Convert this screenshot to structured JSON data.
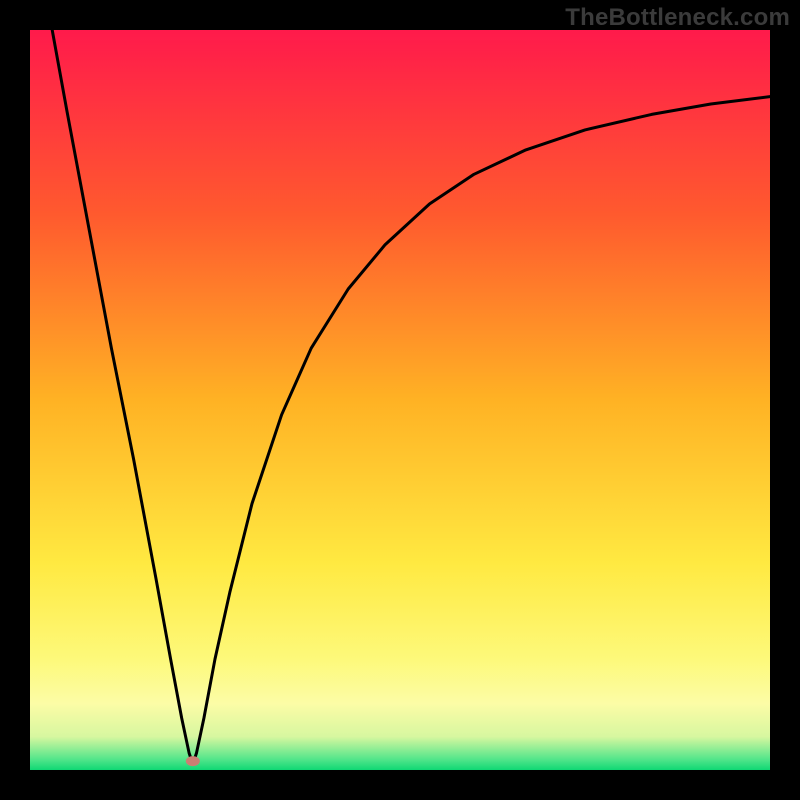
{
  "watermark": "TheBottleneck.com",
  "chart_data": {
    "type": "line",
    "title": "",
    "xlabel": "",
    "ylabel": "",
    "xlim": [
      0,
      100
    ],
    "ylim": [
      0,
      100
    ],
    "grid": false,
    "legend": false,
    "background_gradient": {
      "stops": [
        {
          "offset": 0.0,
          "color": "#ff1a4b"
        },
        {
          "offset": 0.25,
          "color": "#ff5a2e"
        },
        {
          "offset": 0.5,
          "color": "#ffb224"
        },
        {
          "offset": 0.72,
          "color": "#ffe941"
        },
        {
          "offset": 0.85,
          "color": "#fdf97a"
        },
        {
          "offset": 0.91,
          "color": "#fcfca6"
        },
        {
          "offset": 0.955,
          "color": "#d7f7a0"
        },
        {
          "offset": 0.985,
          "color": "#55e68b"
        },
        {
          "offset": 1.0,
          "color": "#0fd874"
        }
      ]
    },
    "marker": {
      "x": 22,
      "y": 1.2,
      "color": "#cc7f73"
    },
    "series": [
      {
        "name": "curve",
        "color": "#000000",
        "x": [
          3,
          5,
          8,
          11,
          14,
          17,
          19,
          20.5,
          21.5,
          22,
          22.5,
          23.5,
          25,
          27,
          30,
          34,
          38,
          43,
          48,
          54,
          60,
          67,
          75,
          84,
          92,
          100
        ],
        "values": [
          100,
          89,
          73,
          57,
          42,
          26,
          15,
          7,
          2.3,
          0.8,
          2.3,
          7,
          15,
          24,
          36,
          48,
          57,
          65,
          71,
          76.5,
          80.5,
          83.8,
          86.5,
          88.6,
          90,
          91
        ]
      }
    ]
  }
}
